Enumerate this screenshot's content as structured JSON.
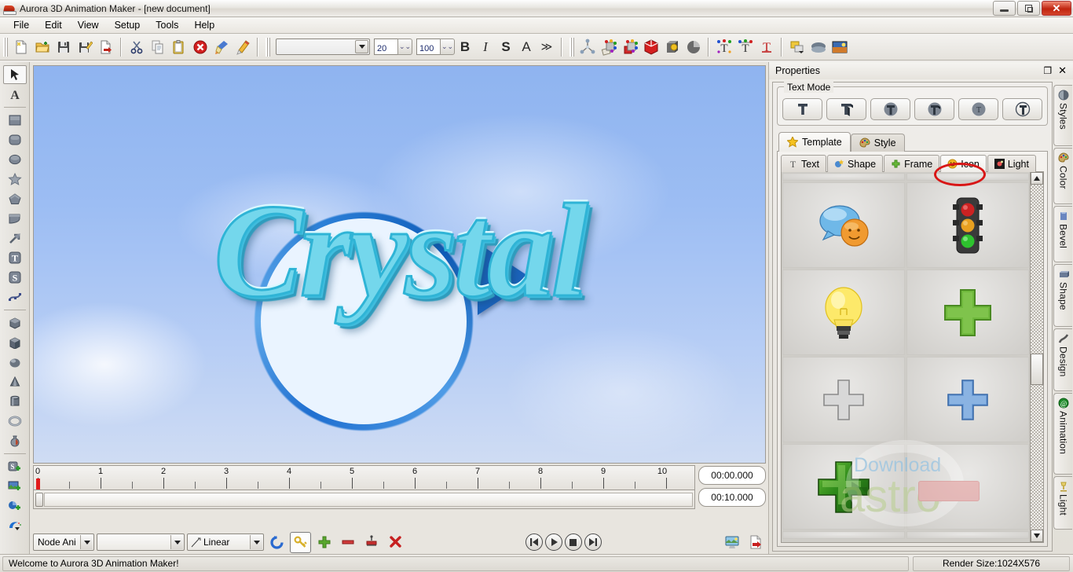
{
  "window": {
    "title": "Aurora 3D Animation Maker - [new document]",
    "controls": {
      "minimize": "–",
      "restore": "❐",
      "close": "✕"
    }
  },
  "menu": {
    "items": [
      "File",
      "Edit",
      "View",
      "Setup",
      "Tools",
      "Help"
    ]
  },
  "toolbar": {
    "file_group": [
      {
        "name": "new-document-icon",
        "label": "New"
      },
      {
        "name": "open-document-icon",
        "label": "Open"
      },
      {
        "name": "save-icon",
        "label": "Save"
      },
      {
        "name": "save-as-icon",
        "label": "Save As"
      },
      {
        "name": "export-icon",
        "label": "Export"
      }
    ],
    "edit_group": [
      {
        "name": "cut-icon",
        "label": "Cut"
      },
      {
        "name": "copy-icon",
        "label": "Copy"
      },
      {
        "name": "paste-icon",
        "label": "Paste"
      },
      {
        "name": "delete-icon",
        "label": "Delete"
      },
      {
        "name": "brush-icon",
        "label": "Brush"
      },
      {
        "name": "pencil-icon",
        "label": "Edit Text"
      }
    ],
    "font_family": "",
    "font_family_placeholder": "",
    "font_size": "20",
    "font_scale": "100",
    "format_buttons": [
      {
        "name": "bold-button",
        "label": "B"
      },
      {
        "name": "italic-button",
        "label": "I"
      },
      {
        "name": "shadow-button",
        "label": "S"
      },
      {
        "name": "outline-button",
        "label": "A"
      },
      {
        "name": "more-format-button",
        "label": "≫"
      }
    ],
    "object_group": [
      {
        "name": "axis-node-icon",
        "label": "Node"
      },
      {
        "name": "color-palette-icon",
        "label": "Color"
      },
      {
        "name": "texture-palette-icon",
        "label": "Texture"
      },
      {
        "name": "bevel-cube-icon",
        "label": "Bevel"
      },
      {
        "name": "shape-icon",
        "label": "Shape"
      },
      {
        "name": "reflect-icon",
        "label": "Reflection"
      }
    ],
    "text_group": [
      {
        "name": "text-node-icon",
        "label": "Text Node"
      },
      {
        "name": "text-align-icon",
        "label": "Text Align"
      },
      {
        "name": "text-shape-icon",
        "label": "Text Shape"
      }
    ],
    "view_group": [
      {
        "name": "layers-icon",
        "label": "Layers"
      },
      {
        "name": "ground-icon",
        "label": "Ground"
      },
      {
        "name": "background-image-icon",
        "label": "Background"
      }
    ]
  },
  "left_tools": [
    {
      "name": "pointer-tool",
      "label": "Select",
      "selected": true
    },
    {
      "name": "text-tool",
      "label": "Text"
    },
    {
      "name": "rectangle-tool",
      "label": "Rectangle"
    },
    {
      "name": "rounded-rectangle-tool",
      "label": "Rounded Rectangle"
    },
    {
      "name": "ellipse-tool",
      "label": "Ellipse"
    },
    {
      "name": "star-tool",
      "label": "Star"
    },
    {
      "name": "pentagon-tool",
      "label": "Pentagon"
    },
    {
      "name": "quad-tool",
      "label": "Quad"
    },
    {
      "name": "arrow-tool",
      "label": "Arrow"
    },
    {
      "name": "text-badge-tool",
      "label": "T Badge"
    },
    {
      "name": "shape-badge-tool",
      "label": "S Badge"
    },
    {
      "name": "path-tool",
      "label": "Path"
    },
    {
      "name": "cube-tool",
      "label": "Cube"
    },
    {
      "name": "box-tool",
      "label": "Box"
    },
    {
      "name": "sphere-tool",
      "label": "Sphere"
    },
    {
      "name": "cone-tool",
      "label": "Cone"
    },
    {
      "name": "cylinder-tool",
      "label": "Cylinder"
    },
    {
      "name": "torus-tool",
      "label": "Torus"
    },
    {
      "name": "vase-tool",
      "label": "Vase"
    },
    {
      "name": "add-shape-tool",
      "label": "Add Shape"
    },
    {
      "name": "add-image-tool",
      "label": "Add Image"
    },
    {
      "name": "add-3d-tool",
      "label": "Add 3D"
    },
    {
      "name": "swoosh-tool",
      "label": "Swoosh"
    }
  ],
  "canvas": {
    "text": "Crystal",
    "sky_top_color": "#8fb4f0",
    "sky_bottom_color": "#cfdcf3",
    "text_color": "#74d7ec",
    "ring_color": "#1f6fd0"
  },
  "timeline": {
    "ticks": [
      "0",
      "1",
      "2",
      "3",
      "4",
      "5",
      "6",
      "7",
      "8",
      "9",
      "10"
    ],
    "current_time": "00:00.000",
    "total_time": "00:10.000",
    "mode": "Node Ani",
    "target": "",
    "easing": "Linear",
    "buttons": [
      {
        "name": "refresh-animation-button",
        "label": "Refresh"
      },
      {
        "name": "keyframe-button",
        "label": "Key",
        "selected": true
      },
      {
        "name": "add-keyframe-button",
        "label": "Add"
      },
      {
        "name": "remove-keyframe-button",
        "label": "Remove"
      },
      {
        "name": "edit-keyframe-button",
        "label": "Edit"
      },
      {
        "name": "delete-all-button",
        "label": "Delete"
      }
    ],
    "playback": [
      {
        "name": "rewind-button",
        "label": "Rewind"
      },
      {
        "name": "play-button",
        "label": "Play"
      },
      {
        "name": "stop-button",
        "label": "Stop"
      },
      {
        "name": "forward-button",
        "label": "Forward"
      }
    ],
    "output": [
      {
        "name": "preview-button",
        "label": "Preview"
      },
      {
        "name": "export-video-button",
        "label": "Export"
      }
    ]
  },
  "properties": {
    "title": "Properties",
    "float_label": "❐",
    "close_label": "✕",
    "text_mode": {
      "label": "Text Mode",
      "buttons": [
        {
          "name": "text-mode-flat",
          "label": "Flat"
        },
        {
          "name": "text-mode-extrude",
          "label": "Extrude"
        },
        {
          "name": "text-mode-bevel",
          "label": "Bevel"
        },
        {
          "name": "text-mode-round",
          "label": "Round"
        },
        {
          "name": "text-mode-emboss",
          "label": "Emboss"
        },
        {
          "name": "text-mode-circle",
          "label": "Circle"
        }
      ]
    },
    "primary_tabs": [
      {
        "name": "tab-template",
        "label": "Template",
        "icon": "star-icon",
        "active": true
      },
      {
        "name": "tab-style",
        "label": "Style",
        "icon": "palette-icon",
        "active": false
      }
    ],
    "secondary_tabs": [
      {
        "name": "tab-text",
        "label": "Text",
        "icon": "text-icon",
        "active": false
      },
      {
        "name": "tab-shape",
        "label": "Shape",
        "icon": "shape-icon",
        "active": false
      },
      {
        "name": "tab-frame",
        "label": "Frame",
        "icon": "frame-icon",
        "active": false
      },
      {
        "name": "tab-icon",
        "label": "Icon",
        "icon": "smiley-icon",
        "active": true,
        "highlighted": true
      },
      {
        "name": "tab-light",
        "label": "Light",
        "icon": "light-icon",
        "active": false
      }
    ],
    "icon_grid": [
      [
        {
          "name": "icon-chat-smiley",
          "label": "Chat Smiley"
        },
        {
          "name": "icon-traffic-light",
          "label": "Traffic Light"
        }
      ],
      [
        {
          "name": "icon-lightbulb",
          "label": "Light Bulb"
        },
        {
          "name": "icon-green-plus-flat",
          "label": "Green Plus"
        }
      ],
      [
        {
          "name": "icon-gray-plus",
          "label": "Gray Plus"
        },
        {
          "name": "icon-blue-plus",
          "label": "Blue Plus"
        }
      ],
      [
        {
          "name": "icon-green-plus-3d",
          "label": "Green 3D Plus"
        },
        {
          "name": "icon-blank",
          "label": "Blank"
        }
      ]
    ],
    "side_tabs": [
      {
        "name": "side-tab-styles",
        "label": "Styles",
        "icon": "styles-icon"
      },
      {
        "name": "side-tab-color",
        "label": "Color",
        "icon": "palette-icon"
      },
      {
        "name": "side-tab-bevel",
        "label": "Bevel",
        "icon": "bevel-icon"
      },
      {
        "name": "side-tab-shape",
        "label": "Shape",
        "icon": "shape-icon"
      },
      {
        "name": "side-tab-design",
        "label": "Design",
        "icon": "design-icon"
      },
      {
        "name": "side-tab-animation",
        "label": "Animation",
        "icon": "animation-icon"
      },
      {
        "name": "side-tab-light",
        "label": "Light",
        "icon": "light-icon"
      }
    ]
  },
  "status": {
    "message": "Welcome to Aurora 3D Animation Maker!",
    "render_size": "Render Size:1024X576"
  },
  "watermark": {
    "line1": "Download",
    "line2": "astro"
  }
}
